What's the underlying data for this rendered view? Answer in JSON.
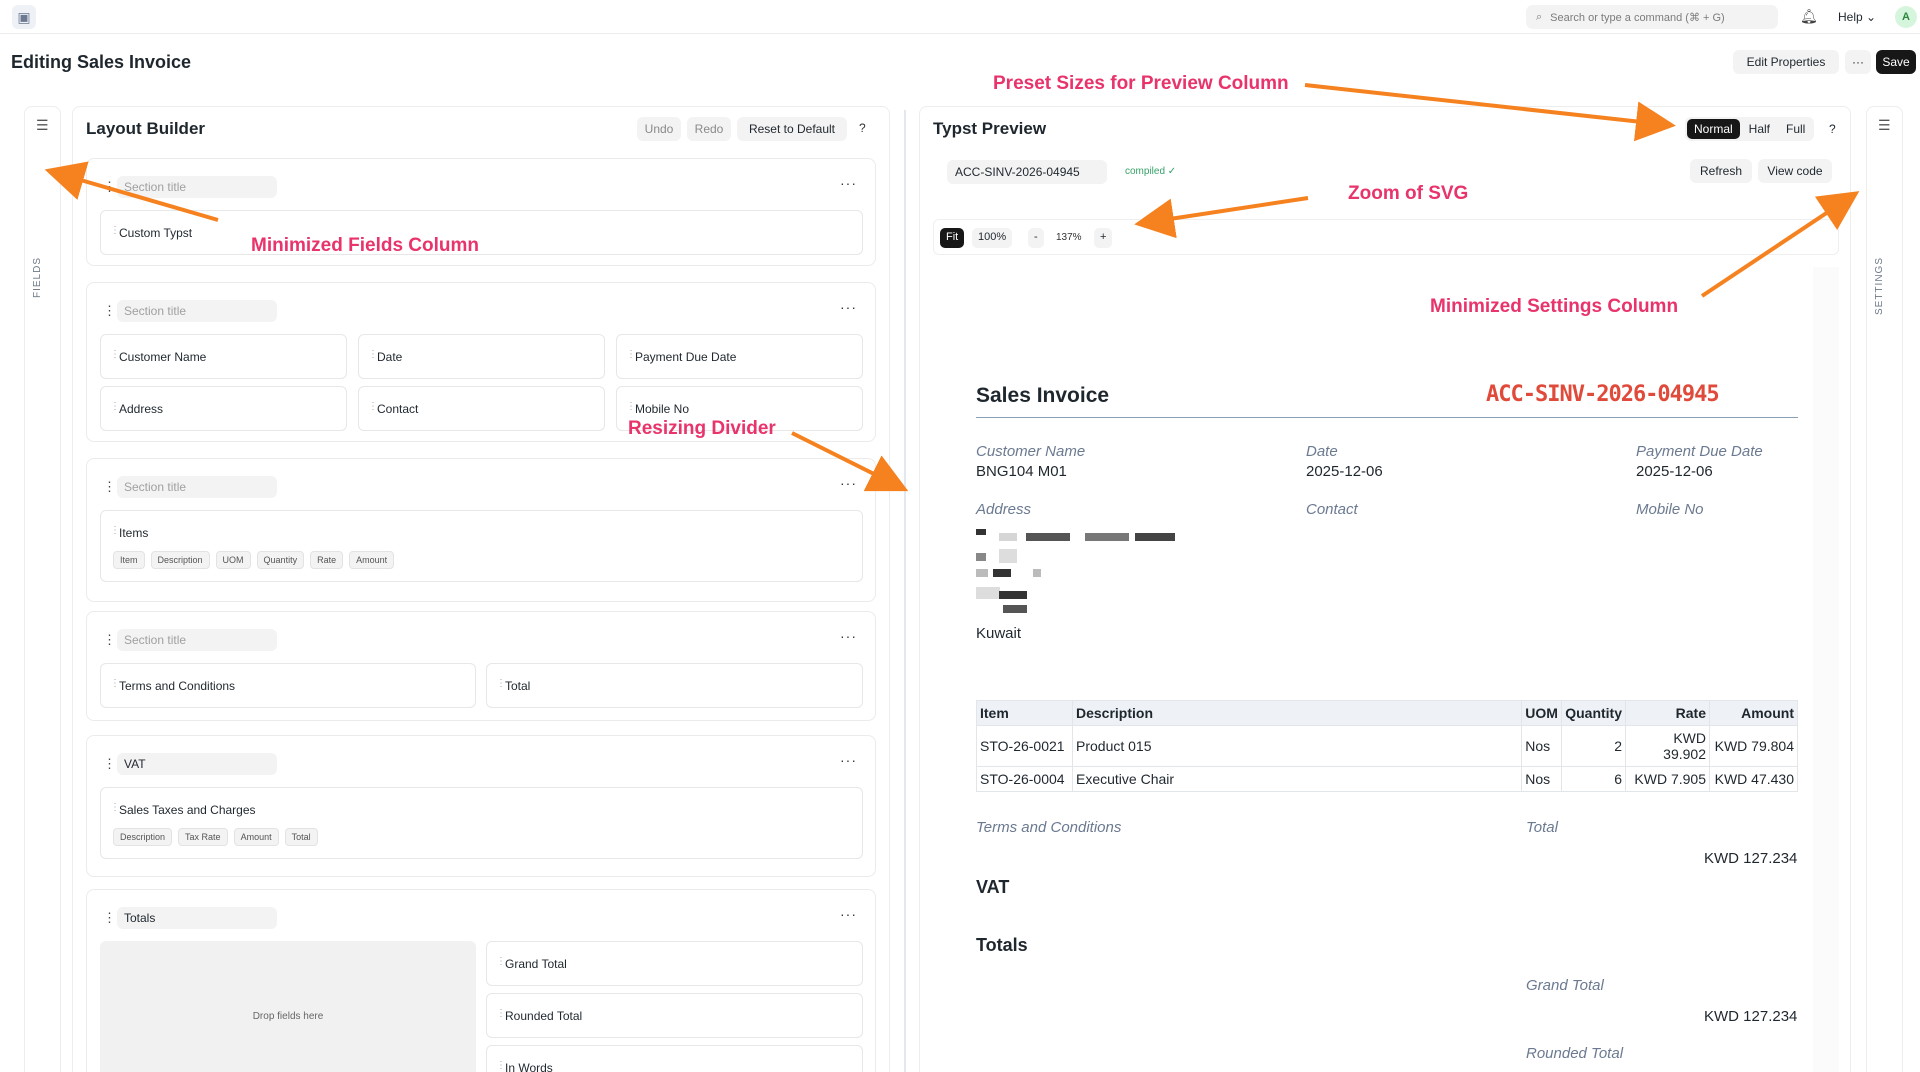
{
  "navbar": {
    "search_placeholder": "Search or type a command (⌘ + G)",
    "help": "Help ⌄",
    "avatar": "A"
  },
  "page": {
    "title": "Editing Sales Invoice",
    "edit_properties": "Edit Properties",
    "more": "···",
    "save": "Save"
  },
  "fields_col": {
    "label": "FIELDS"
  },
  "settings_col": {
    "label": "SETTINGS"
  },
  "layout_builder": {
    "title": "Layout Builder",
    "undo": "Undo",
    "redo": "Redo",
    "reset": "Reset to Default",
    "help": "?",
    "sections": [
      {
        "title": "Section title",
        "fields": [
          "Custom Typst"
        ]
      },
      {
        "title": "Section title",
        "fields": [
          "Customer Name",
          "Date",
          "Payment Due Date",
          "Address",
          "Contact",
          "Mobile No"
        ]
      },
      {
        "title": "Section title",
        "field": "Items",
        "chips": [
          "Item",
          "Description",
          "UOM",
          "Quantity",
          "Rate",
          "Amount"
        ]
      },
      {
        "title": "Section title",
        "fields": [
          "Terms and Conditions",
          "Total"
        ]
      },
      {
        "title": "VAT",
        "field": "Sales Taxes and Charges",
        "chips": [
          "Description",
          "Tax Rate",
          "Amount",
          "Total"
        ]
      },
      {
        "title": "Totals",
        "dropzone": "Drop fields here",
        "fields": [
          "Grand Total",
          "Rounded Total",
          "In Words"
        ]
      }
    ]
  },
  "preview": {
    "title": "Typst Preview",
    "sizes": [
      "Normal",
      "Half",
      "Full"
    ],
    "help": "?",
    "doc_name": "ACC-SINV-2026-04945",
    "compiled": "compiled ✓",
    "refresh": "Refresh",
    "view_code": "View code",
    "zoom": {
      "fit": "Fit",
      "hundred": "100%",
      "minus": "-",
      "value": "137%",
      "plus": "+"
    },
    "document": {
      "title": "Sales Invoice",
      "id": "ACC-SINV-2026-04945",
      "customer_label": "Customer Name",
      "customer_value": "BNG104 M01",
      "date_label": "Date",
      "date_value": "2025-12-06",
      "due_label": "Payment Due Date",
      "due_value": "2025-12-06",
      "address_label": "Address",
      "contact_label": "Contact",
      "mobile_label": "Mobile No",
      "country": "Kuwait",
      "table_headers": [
        "Item",
        "Description",
        "UOM",
        "Quantity",
        "Rate",
        "Amount"
      ],
      "rows": [
        [
          "STO-26-0021",
          "Product 015",
          "Nos",
          "2",
          "KWD 39.902",
          "KWD 79.804"
        ],
        [
          "STO-26-0004",
          "Executive Chair",
          "Nos",
          "6",
          "KWD 7.905",
          "KWD 47.430"
        ]
      ],
      "terms_label": "Terms and Conditions",
      "total_label": "Total",
      "total_value": "KWD 127.234",
      "vat_heading": "VAT",
      "totals_heading": "Totals",
      "grand_total_label": "Grand Total",
      "grand_total_value": "KWD 127.234",
      "rounded_total_label": "Rounded Total"
    }
  },
  "annotations": {
    "preset": "Preset Sizes for Preview Column",
    "zoom": "Zoom of SVG",
    "fields": "Minimized Fields Column",
    "settings": "Minimized Settings Column",
    "divider": "Resizing Divider"
  },
  "colors": {
    "annotation": "#e8336b",
    "arrow": "#f5821f",
    "doc_id": "#e04a3a"
  }
}
